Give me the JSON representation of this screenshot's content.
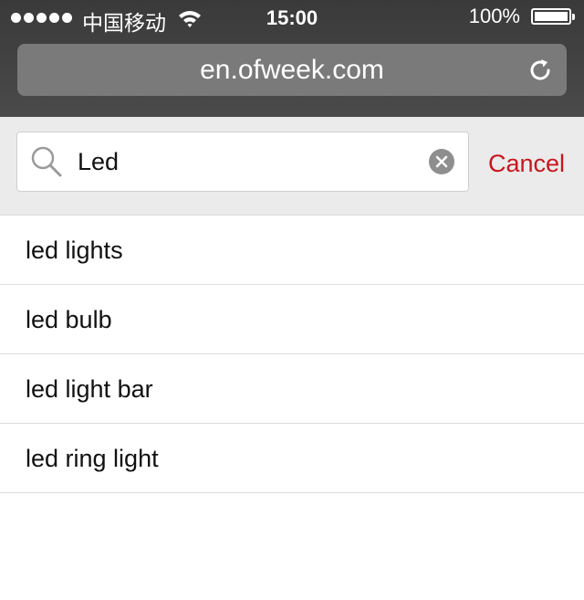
{
  "status_bar": {
    "carrier": "中国移动",
    "time": "15:00",
    "battery": "100%",
    "battery_level": 1.0,
    "signal_bars": 5
  },
  "browser": {
    "url": "en.ofweek.com",
    "reload_icon": "reload-icon"
  },
  "search": {
    "query": "Led",
    "search_icon": "magnifier-icon",
    "clear_icon": "clear-circle-icon",
    "cancel_label": "Cancel"
  },
  "suggestions": [
    {
      "label": "led lights"
    },
    {
      "label": "led bulb"
    },
    {
      "label": "led light bar"
    },
    {
      "label": "led ring light"
    }
  ],
  "colors": {
    "accent": "#c8161d",
    "toolbar": "#444444",
    "url_field": "#7a7a7a",
    "search_band": "#ebebeb"
  }
}
